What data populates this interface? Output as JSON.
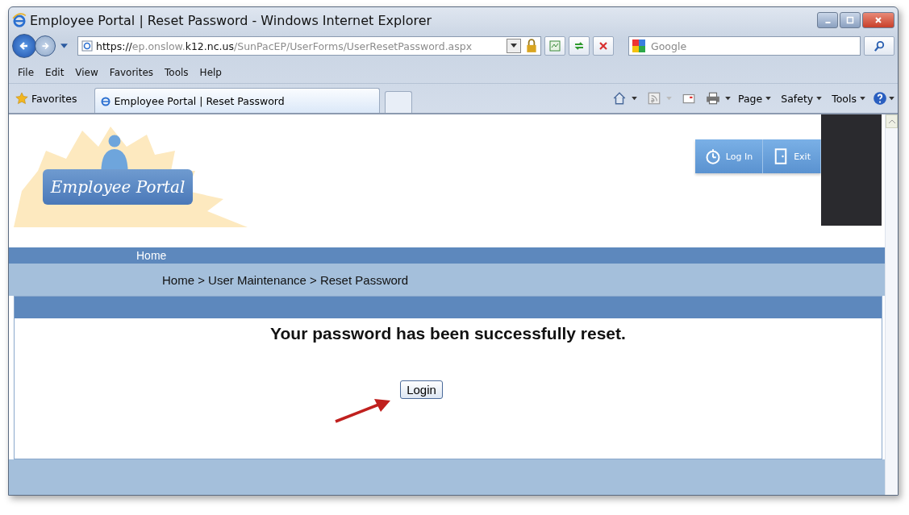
{
  "window": {
    "title": "Employee Portal | Reset Password - Windows Internet Explorer"
  },
  "address_bar": {
    "scheme": "https://",
    "host_prefix": "ep.onslow.",
    "domain": "k12.nc.us",
    "path": "/SunPacEP/UserForms/UserResetPassword.aspx"
  },
  "search": {
    "placeholder": "Google"
  },
  "menu": [
    "File",
    "Edit",
    "View",
    "Favorites",
    "Tools",
    "Help"
  ],
  "favorites": {
    "label": "Favorites"
  },
  "tabs": [
    {
      "label": "Employee Portal | Reset Password",
      "selected": true
    }
  ],
  "command_bar": [
    "Page",
    "Safety",
    "Tools"
  ],
  "page": {
    "logo": "Employee Portal",
    "header_buttons": [
      {
        "label": "Log In",
        "kind": "login"
      },
      {
        "label": "Exit",
        "kind": "exit"
      }
    ],
    "nav": [
      "Home"
    ],
    "breadcrumb": "Home > User Maintenance > Reset Password",
    "message": "Your password has been successfully reset.",
    "button": "Login"
  }
}
